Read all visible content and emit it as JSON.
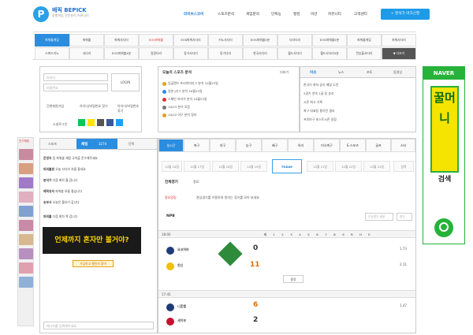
{
  "brand": {
    "name": "베픽 BEPICK",
    "slogan": "동행게임 전문분석 커뮤니티",
    "logo_letter": "P"
  },
  "nav": [
    "라이브스코어",
    "스포츠분석",
    "게임분석",
    "단폭농",
    "랭킹",
    "미션",
    "커뮤니티",
    "고객센터"
  ],
  "biz_button": "+ 분석가 마크신청",
  "subnav_row1": [
    "파워볼게임",
    "파워볼",
    "파워사다리",
    "EOS파워볼",
    "EOS파워사다리",
    "키노사다리",
    "EOS파워볼3분",
    "다리다리",
    "EOS파워볼5분"
  ],
  "subnav_row1_first": "파워볼게임",
  "subnav_row2": [
    "스피드키노",
    "사다리",
    "EOS파워볼4분",
    "일정다리",
    "동기사다리",
    "동기다리",
    "한국사다리",
    "월드사다리",
    "월드사다리3분",
    "런승출사다리",
    "순위사다리"
  ],
  "subnav_more": "▼ 더보기",
  "login": {
    "id_placeholder": "아이디",
    "pw_placeholder": "비밀번호",
    "button": "LOGIN",
    "join": "간편회원가입",
    "find": "아이디/비밀번호 찾기",
    "social_label": "소셜로그인"
  },
  "today": {
    "title": "오늘의 스포츠 분석",
    "more": "더보기",
    "items": [
      "잉글랜드 프리미어리그 분석 10월23일",
      "일본 J리그 분석 10월23일",
      "스페인 라리가 분석 10월23일",
      "10/23 분석 모음",
      "10/22 야구 분석 정리"
    ]
  },
  "news": {
    "tabs": [
      "이슈",
      "뉴스",
      "포토",
      "동영상"
    ],
    "items": [
      "한국이 최하 승리 메달 도전",
      "5경기 연속 1골 팀 승리",
      "시즌 최고 기록",
      "축구 대표팀 평가전 결과",
      "프로야구 포스트시즌 일정"
    ]
  },
  "chat": {
    "tabs": [
      "스포츠",
      "채팅",
      "단폭"
    ],
    "count": "3274",
    "messages": [
      {
        "user": "운영자",
        "text": "팀 파워볼 채팅 규칙을 준수해주세요"
      },
      {
        "user": "파워볼왕",
        "text": "오늘 사다리 흐름 좋네요"
      },
      {
        "user": "분석가",
        "text": "다음 회차 홀 갑니다"
      },
      {
        "user": "베픽유저",
        "text": "파워볼 흐름 좋습니다"
      },
      {
        "user": "승부사",
        "text": "오늘은 줄타기 갑니다"
      },
      {
        "user": "파워볼",
        "text": "다음 회차 짝 갑니다"
      }
    ],
    "banner": "언제까지 혼자만 볼거야?",
    "banner_btn": "가입하고 챌린지 참여",
    "input_placeholder": "메시지를 입력해주세요",
    "thumb_label": "인기채팅"
  },
  "sports": {
    "tabs": [
      "실시간",
      "축구",
      "야구",
      "농구",
      "배구",
      "하키",
      "미식축구",
      "E-스포츠",
      "골프",
      "스타"
    ],
    "dates": [
      "10월 16일",
      "10월 17일",
      "10월 18일",
      "10월 19일",
      "TODAY",
      "10월 21일",
      "10월 22일",
      "10월 23일",
      "달력"
    ],
    "filter": [
      "전체경기",
      "종료"
    ],
    "notice_label": "중요알림",
    "notice": "관심경기를 이용하여 원하는 경기를 모아 보세요",
    "league": "NPB",
    "league_btns": [
      "관심경기 설정",
      "접기"
    ],
    "cols": [
      "회",
      "1",
      "2",
      "3",
      "4",
      "5",
      "6",
      "7",
      "8",
      "9",
      "R",
      "H",
      "E"
    ],
    "games": [
      {
        "time": "18:00",
        "home": "요코하마",
        "away": "한신",
        "hs": "0",
        "as": "11",
        "stat": "종료"
      },
      {
        "time": "17:45",
        "home": "니혼햄",
        "away": "세이부",
        "hs": "6",
        "as": "2",
        "stat": "종료"
      }
    ],
    "odds": [
      "1.73",
      "2.11",
      "1.47"
    ]
  },
  "ad": {
    "title": "NAVER",
    "keyword": "꿀머니",
    "search": "검색"
  }
}
